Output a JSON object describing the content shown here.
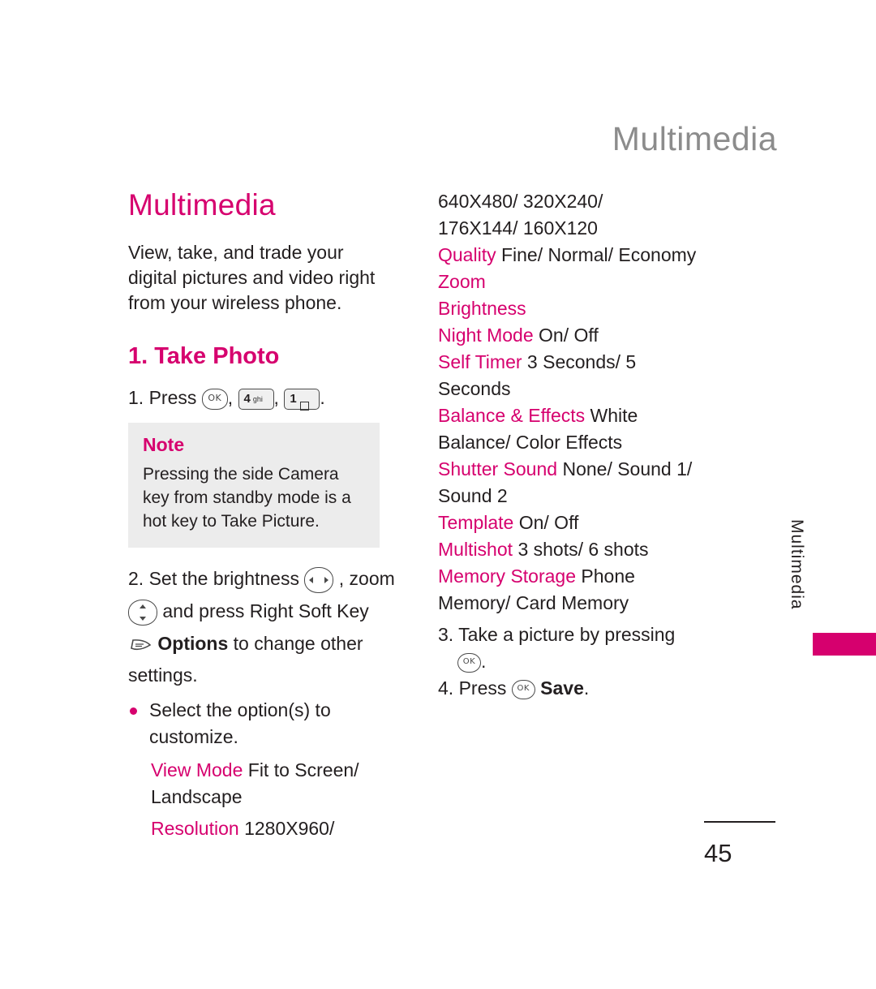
{
  "header": {
    "title": "Multimedia"
  },
  "left": {
    "chapter_title": "Multimedia",
    "intro": "View, take, and trade your digital pictures and video right from your wireless phone.",
    "section_title": "1. Take Photo",
    "step1_prefix": "1. Press",
    "step1_comma1": ",",
    "step1_comma2": ",",
    "step1_period": ".",
    "key_ok_label": "OK",
    "key_4_number": "4",
    "key_4_sub": "ghi",
    "key_1_number": "1",
    "note": {
      "title": "Note",
      "body": "Pressing the side Camera key from standby mode is a hot key to Take Picture."
    },
    "step2_a": "2. Set the brightness",
    "step2_b": ", zoom",
    "step2_c": "and press Right Soft Key",
    "step2_options": "Options",
    "step2_d": "to change other",
    "step2_e": "settings.",
    "bullet1": "Select the option(s) to customize.",
    "view_mode_label": "View Mode",
    "view_mode_value": "Fit to Screen/ Landscape",
    "resolution_label": "Resolution",
    "resolution_value": "1280X960/"
  },
  "right": {
    "resolution_cont1": "640X480/ 320X240/",
    "resolution_cont2": "176X144/ 160X120",
    "quality_label": "Quality",
    "quality_value": "Fine/ Normal/ Economy",
    "zoom_label": "Zoom",
    "brightness_label": "Brightness",
    "night_mode_label": "Night Mode",
    "night_mode_value": "On/ Off",
    "self_timer_label": "Self Timer",
    "self_timer_value": "3 Seconds/ 5 Seconds",
    "balance_label": "Balance & Effects",
    "balance_value": "White Balance/ Color Effects",
    "shutter_label": "Shutter Sound",
    "shutter_value": "None/ Sound 1/ Sound 2",
    "template_label": "Template",
    "template_value": "On/ Off",
    "multishot_label": "Multishot",
    "multishot_value": "3 shots/ 6 shots",
    "memory_label": "Memory Storage",
    "memory_value": "Phone Memory/ Card Memory",
    "step3": "3. Take a picture by pressing",
    "step3_period": ".",
    "step4_prefix": "4. Press",
    "step4_save": "Save",
    "step4_period": "."
  },
  "side_tab_text": "Multimedia",
  "page_number": "45"
}
